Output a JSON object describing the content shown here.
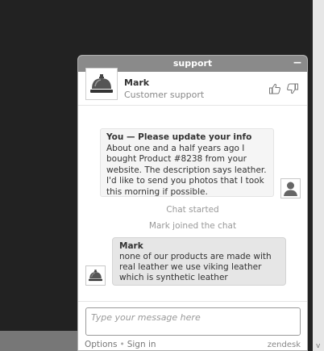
{
  "widget": {
    "title": "support",
    "minimize_label": "−"
  },
  "agent": {
    "name": "Mark",
    "title": "Customer support"
  },
  "messages": {
    "visitor": {
      "title": "You — Please update your info",
      "body": "About one and a half years ago I bought Product #8238 from your website. The description says leather. I'd like to send you photos that I took this morning if possible."
    },
    "system": [
      "Chat started",
      "Mark joined the chat"
    ],
    "agent": {
      "sender": "Mark",
      "body": "none of our products are made with real leather  we use viking leather which is synthetic leather"
    }
  },
  "input": {
    "placeholder": "Type your message here"
  },
  "footer": {
    "options": "Options",
    "separator": "•",
    "sign_in": "Sign in",
    "brand": "zendesk"
  },
  "icons": {
    "agent_avatar": "service-bell-icon",
    "visitor_avatar": "user-silhouette-icon",
    "rate_up": "thumbs-up-icon",
    "rate_down": "thumbs-down-icon",
    "scroll_down": "chevron-down-icon"
  },
  "colors": {
    "page_background": "#222222",
    "titlebar": "#8a8a8a",
    "visitor_bubble": "#f5f5f5",
    "agent_bubble": "#e6e6e6"
  }
}
